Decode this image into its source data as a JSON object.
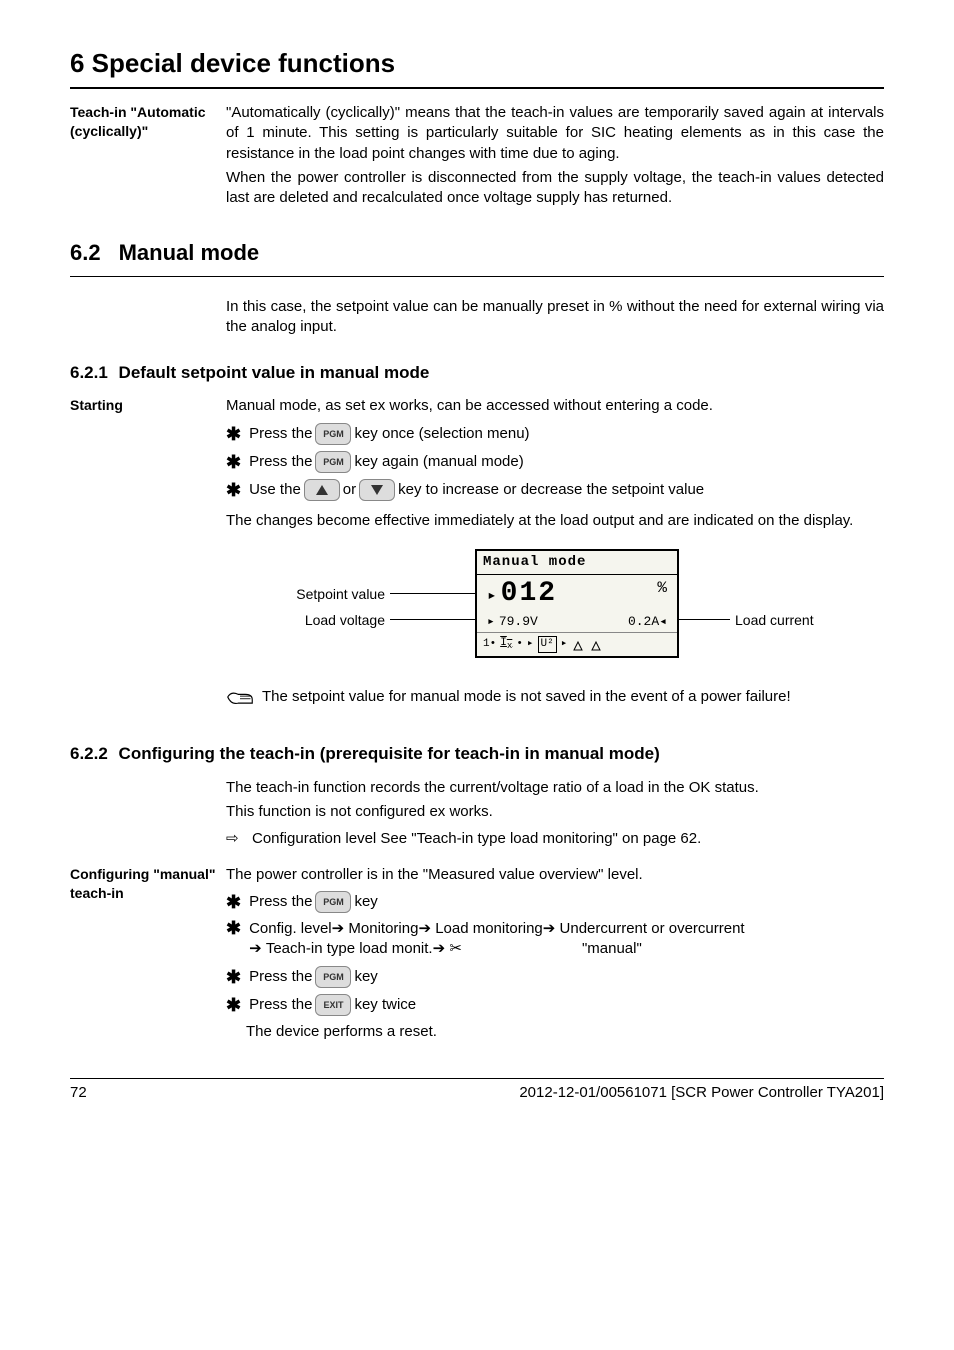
{
  "chapter": {
    "title": "6 Special device functions"
  },
  "block_teachin_auto": {
    "side": "Teach-in \"Automatic (cyclically)\"",
    "p1": "\"Automatically (cyclically)\" means that the teach-in values are temporarily saved again at intervals of 1 minute. This setting is particularly suitable for SIC heating elements as in this case the resistance in the load point changes with time due to aging.",
    "p2": "When the power controller is disconnected from the supply voltage, the teach-in values detected last are deleted and recalculated once voltage supply has returned."
  },
  "section_6_2": {
    "num": "6.2",
    "title": "Manual mode",
    "intro": "In this case, the setpoint value can be manually preset in % without the need for external wiring via the analog input."
  },
  "section_6_2_1": {
    "num": "6.2.1",
    "title": "Default setpoint value in manual mode"
  },
  "starting": {
    "side": "Starting",
    "intro": "Manual mode, as set ex works, can be accessed without entering a code.",
    "step1_a": "Press the ",
    "step1_b": " key once (selection menu)",
    "step2_a": "Press the ",
    "step2_b": " key again (manual mode)",
    "step3_a": "Use the ",
    "step3_mid": " or ",
    "step3_b": " key to increase or decrease the setpoint value",
    "outcome": "The changes become effective immediately at the load output and are indicated on the display."
  },
  "keys": {
    "pgm": "PGM",
    "exit": "EXIT"
  },
  "diagram": {
    "label_setpoint": "Setpoint value",
    "label_loadv": "Load voltage",
    "label_loadc": "Load current",
    "lcd_title": "Manual mode",
    "lcd_big": "012",
    "lcd_pct": "%",
    "lcd_v": "79.9V",
    "lcd_a": "0.2A"
  },
  "note1": "The setpoint value for manual mode is not saved in the event of a power failure!",
  "section_6_2_2": {
    "num": "6.2.2",
    "title": "Configuring the teach-in (prerequisite for teach-in in manual mode)",
    "p1": "The teach-in function records the current/voltage ratio of a load in the OK status.",
    "p2": "This function is not configured ex works.",
    "link": "Configuration level See \"Teach-in type load monitoring\" on page 62."
  },
  "config_block": {
    "side": "Configuring \"manual\" teach-in",
    "intro": "The power controller is in the \"Measured value overview\" level.",
    "s1_a": "Press the ",
    "s1_b": " key",
    "s2_a": " Config. level ",
    "s2_arrow": "➔",
    "s2_m": "Monitoring ",
    "s2_l": "Load monitoring ",
    "s2_u": "Undercurrent or overcurrent ",
    "s2_t": "Teach-in type load monit. ",
    "s2_end": "\"manual\"",
    "s3_a": "Press the ",
    "s3_b": " key",
    "s4_a": "Press the ",
    "s4_b": " key twice",
    "s4_sub": "The device performs a reset."
  },
  "footer": {
    "page": "72",
    "text": "2012-12-01/00561071 [SCR Power Controller TYA201]"
  }
}
